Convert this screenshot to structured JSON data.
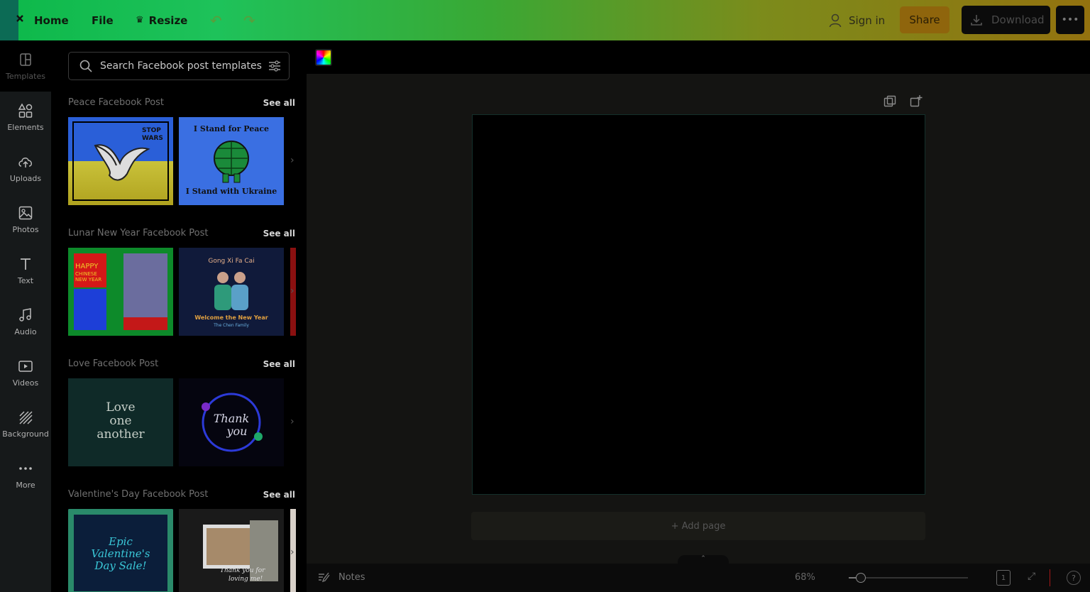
{
  "topbar": {
    "home_label": "Home",
    "file_label": "File",
    "resize_label": "Resize",
    "signin_label": "Sign in",
    "share_label": "Share",
    "download_label": "Download"
  },
  "rail": {
    "items": [
      {
        "label": "Templates",
        "icon": "templates-icon"
      },
      {
        "label": "Elements",
        "icon": "elements-icon"
      },
      {
        "label": "Uploads",
        "icon": "upload-icon"
      },
      {
        "label": "Photos",
        "icon": "photo-icon"
      },
      {
        "label": "Text",
        "icon": "text-icon"
      },
      {
        "label": "Audio",
        "icon": "audio-icon"
      },
      {
        "label": "Videos",
        "icon": "video-icon"
      },
      {
        "label": "Background",
        "icon": "background-icon"
      },
      {
        "label": "More",
        "icon": "more-icon"
      }
    ]
  },
  "panel": {
    "search_placeholder": "Search Facebook post templates",
    "see_all": "See all",
    "sections": [
      {
        "title": "Peace Facebook Post",
        "thumbs": [
          {
            "lines": [
              "STOP",
              "WARS"
            ]
          },
          {
            "lines": [
              "I Stand for Peace",
              "I Stand with Ukraine"
            ]
          }
        ]
      },
      {
        "title": "Lunar New Year Facebook Post",
        "thumbs": [
          {
            "lines": [
              "HAPPY",
              "CHINESE",
              "NEW YEAR"
            ]
          },
          {
            "lines": [
              "Gong Xi Fa Cai",
              "Welcome the New Year",
              "The Chen Family"
            ]
          }
        ]
      },
      {
        "title": "Love Facebook Post",
        "thumbs": [
          {
            "lines": [
              "Love",
              "one",
              "another"
            ]
          },
          {
            "lines": [
              "Thank",
              "you"
            ]
          }
        ]
      },
      {
        "title": "Valentine's Day Facebook Post",
        "thumbs": [
          {
            "lines": [
              "Epic",
              "Valentine's",
              "Day Sale!"
            ]
          },
          {
            "lines": [
              "Thank you for",
              "loving me!"
            ]
          }
        ]
      }
    ]
  },
  "canvas": {
    "add_page_label": "+ Add page"
  },
  "bottombar": {
    "notes_label": "Notes",
    "zoom_value": "68%",
    "zoom_fraction": 0.1,
    "page_count": "1"
  },
  "colors": {
    "topbar_start": "#0db84a",
    "topbar_end": "#93720f",
    "share_bg": "#8f650c",
    "rail_bg": "#16191a",
    "workspace_bg": "#141412"
  }
}
